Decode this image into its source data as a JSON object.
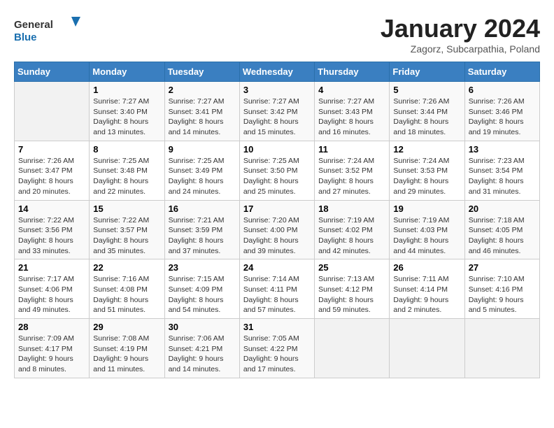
{
  "logo": {
    "line1": "General",
    "line2": "Blue"
  },
  "title": "January 2024",
  "subtitle": "Zagorz, Subcarpathia, Poland",
  "days_of_week": [
    "Sunday",
    "Monday",
    "Tuesday",
    "Wednesday",
    "Thursday",
    "Friday",
    "Saturday"
  ],
  "weeks": [
    [
      {
        "day": "",
        "info": ""
      },
      {
        "day": "1",
        "info": "Sunrise: 7:27 AM\nSunset: 3:40 PM\nDaylight: 8 hours\nand 13 minutes."
      },
      {
        "day": "2",
        "info": "Sunrise: 7:27 AM\nSunset: 3:41 PM\nDaylight: 8 hours\nand 14 minutes."
      },
      {
        "day": "3",
        "info": "Sunrise: 7:27 AM\nSunset: 3:42 PM\nDaylight: 8 hours\nand 15 minutes."
      },
      {
        "day": "4",
        "info": "Sunrise: 7:27 AM\nSunset: 3:43 PM\nDaylight: 8 hours\nand 16 minutes."
      },
      {
        "day": "5",
        "info": "Sunrise: 7:26 AM\nSunset: 3:44 PM\nDaylight: 8 hours\nand 18 minutes."
      },
      {
        "day": "6",
        "info": "Sunrise: 7:26 AM\nSunset: 3:46 PM\nDaylight: 8 hours\nand 19 minutes."
      }
    ],
    [
      {
        "day": "7",
        "info": "Sunrise: 7:26 AM\nSunset: 3:47 PM\nDaylight: 8 hours\nand 20 minutes."
      },
      {
        "day": "8",
        "info": "Sunrise: 7:25 AM\nSunset: 3:48 PM\nDaylight: 8 hours\nand 22 minutes."
      },
      {
        "day": "9",
        "info": "Sunrise: 7:25 AM\nSunset: 3:49 PM\nDaylight: 8 hours\nand 24 minutes."
      },
      {
        "day": "10",
        "info": "Sunrise: 7:25 AM\nSunset: 3:50 PM\nDaylight: 8 hours\nand 25 minutes."
      },
      {
        "day": "11",
        "info": "Sunrise: 7:24 AM\nSunset: 3:52 PM\nDaylight: 8 hours\nand 27 minutes."
      },
      {
        "day": "12",
        "info": "Sunrise: 7:24 AM\nSunset: 3:53 PM\nDaylight: 8 hours\nand 29 minutes."
      },
      {
        "day": "13",
        "info": "Sunrise: 7:23 AM\nSunset: 3:54 PM\nDaylight: 8 hours\nand 31 minutes."
      }
    ],
    [
      {
        "day": "14",
        "info": "Sunrise: 7:22 AM\nSunset: 3:56 PM\nDaylight: 8 hours\nand 33 minutes."
      },
      {
        "day": "15",
        "info": "Sunrise: 7:22 AM\nSunset: 3:57 PM\nDaylight: 8 hours\nand 35 minutes."
      },
      {
        "day": "16",
        "info": "Sunrise: 7:21 AM\nSunset: 3:59 PM\nDaylight: 8 hours\nand 37 minutes."
      },
      {
        "day": "17",
        "info": "Sunrise: 7:20 AM\nSunset: 4:00 PM\nDaylight: 8 hours\nand 39 minutes."
      },
      {
        "day": "18",
        "info": "Sunrise: 7:19 AM\nSunset: 4:02 PM\nDaylight: 8 hours\nand 42 minutes."
      },
      {
        "day": "19",
        "info": "Sunrise: 7:19 AM\nSunset: 4:03 PM\nDaylight: 8 hours\nand 44 minutes."
      },
      {
        "day": "20",
        "info": "Sunrise: 7:18 AM\nSunset: 4:05 PM\nDaylight: 8 hours\nand 46 minutes."
      }
    ],
    [
      {
        "day": "21",
        "info": "Sunrise: 7:17 AM\nSunset: 4:06 PM\nDaylight: 8 hours\nand 49 minutes."
      },
      {
        "day": "22",
        "info": "Sunrise: 7:16 AM\nSunset: 4:08 PM\nDaylight: 8 hours\nand 51 minutes."
      },
      {
        "day": "23",
        "info": "Sunrise: 7:15 AM\nSunset: 4:09 PM\nDaylight: 8 hours\nand 54 minutes."
      },
      {
        "day": "24",
        "info": "Sunrise: 7:14 AM\nSunset: 4:11 PM\nDaylight: 8 hours\nand 57 minutes."
      },
      {
        "day": "25",
        "info": "Sunrise: 7:13 AM\nSunset: 4:12 PM\nDaylight: 8 hours\nand 59 minutes."
      },
      {
        "day": "26",
        "info": "Sunrise: 7:11 AM\nSunset: 4:14 PM\nDaylight: 9 hours\nand 2 minutes."
      },
      {
        "day": "27",
        "info": "Sunrise: 7:10 AM\nSunset: 4:16 PM\nDaylight: 9 hours\nand 5 minutes."
      }
    ],
    [
      {
        "day": "28",
        "info": "Sunrise: 7:09 AM\nSunset: 4:17 PM\nDaylight: 9 hours\nand 8 minutes."
      },
      {
        "day": "29",
        "info": "Sunrise: 7:08 AM\nSunset: 4:19 PM\nDaylight: 9 hours\nand 11 minutes."
      },
      {
        "day": "30",
        "info": "Sunrise: 7:06 AM\nSunset: 4:21 PM\nDaylight: 9 hours\nand 14 minutes."
      },
      {
        "day": "31",
        "info": "Sunrise: 7:05 AM\nSunset: 4:22 PM\nDaylight: 9 hours\nand 17 minutes."
      },
      {
        "day": "",
        "info": ""
      },
      {
        "day": "",
        "info": ""
      },
      {
        "day": "",
        "info": ""
      }
    ]
  ]
}
